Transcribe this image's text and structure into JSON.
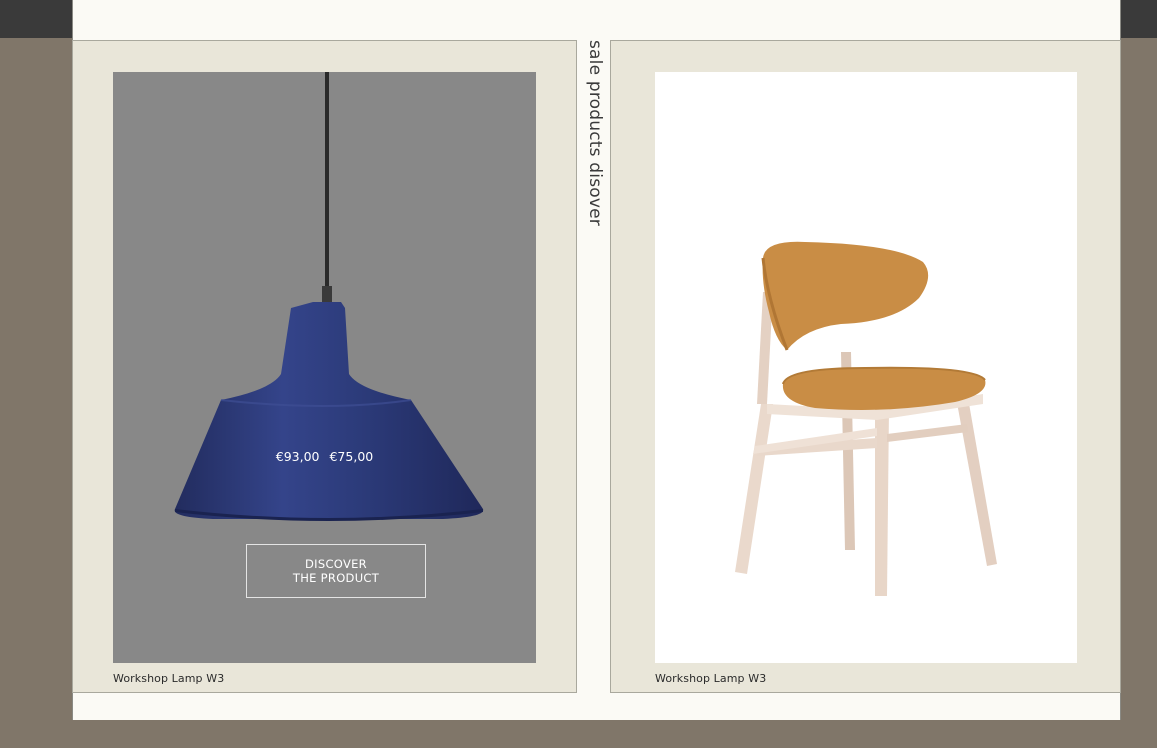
{
  "section": {
    "vertical_label": "sale products disover"
  },
  "cards": [
    {
      "product_name": "Workshop Lamp W3",
      "old_price": "€93,00",
      "new_price": "€75,00",
      "cta_line1": "DISCOVER",
      "cta_line2": "THE PRODUCT"
    },
    {
      "product_name": "Workshop Lamp W3"
    }
  ],
  "colors": {
    "page_background": "#807669",
    "card_background": "#e9e6d9",
    "lamp_backdrop": "#888888",
    "lamp_shade": "#2f3d7c",
    "chair_upholstery": "#c98d45",
    "chair_wood": "#e6d3c4"
  }
}
